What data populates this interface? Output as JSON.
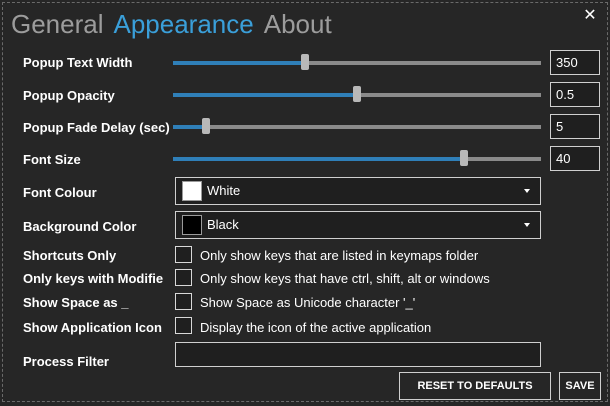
{
  "tabs": [
    {
      "label": "General",
      "active": false
    },
    {
      "label": "Appearance",
      "active": true
    },
    {
      "label": "About",
      "active": false
    }
  ],
  "close_glyph": "✕",
  "sliders": [
    {
      "label": "Popup Text Width",
      "value": "350",
      "fraction": 0.36
    },
    {
      "label": "Popup Opacity",
      "value": "0.5",
      "fraction": 0.5
    },
    {
      "label": "Popup Fade Delay (sec)",
      "value": "5",
      "fraction": 0.09
    },
    {
      "label": "Font Size",
      "value": "40",
      "fraction": 0.79
    }
  ],
  "font_colour": {
    "label": "Font Colour",
    "value": "White",
    "swatch": "#ffffff"
  },
  "background_color": {
    "label": "Background Color",
    "value": "Black",
    "swatch": "#000000"
  },
  "options": [
    {
      "label": "Shortcuts Only",
      "text": "Only show keys that are listed in keymaps folder",
      "checked": false
    },
    {
      "label": "Only keys with Modifie",
      "text": "Only show keys that have ctrl, shift, alt or windows",
      "checked": false
    },
    {
      "label": "Show Space as _",
      "text": "Show Space as Unicode character '_'",
      "checked": false
    },
    {
      "label": "Show Application Icon",
      "text": "Display the icon of the active application",
      "checked": false
    }
  ],
  "process_filter": {
    "label": "Process Filter",
    "value": ""
  },
  "buttons": {
    "reset": "RESET TO DEFAULTS",
    "save": "SAVE"
  },
  "colors": {
    "accent": "#3a9fd9",
    "slider_fill": "#2f7fb8",
    "background": "#262626"
  }
}
